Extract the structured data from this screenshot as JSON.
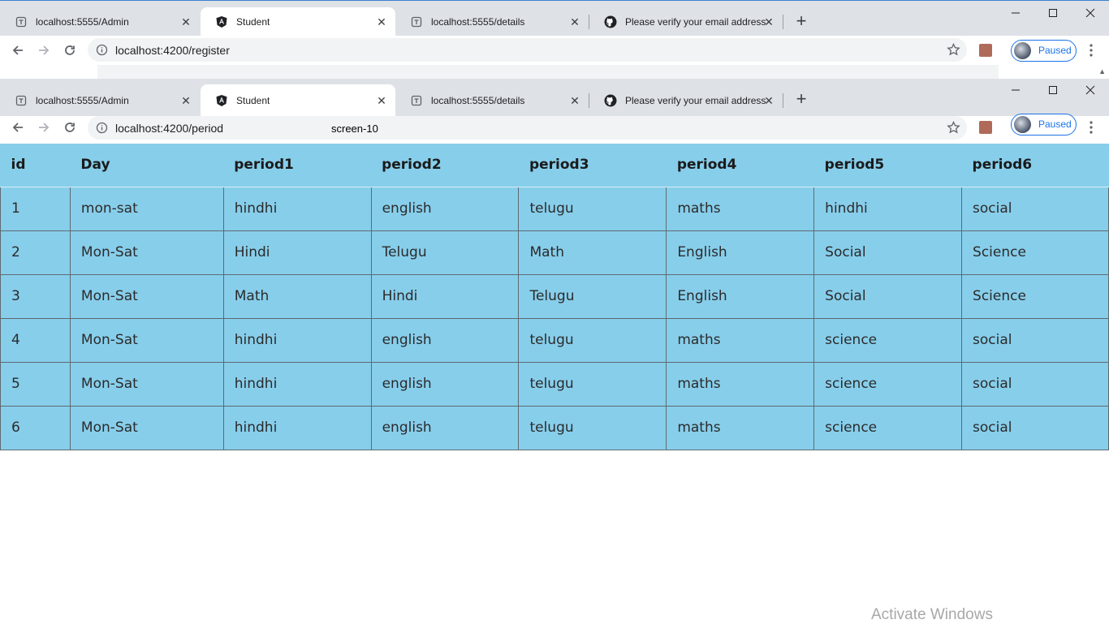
{
  "back_window": {
    "tabs": [
      {
        "label": "localhost:5555/Admin",
        "icon": "page-icon",
        "active": false
      },
      {
        "label": "Student",
        "icon": "angular-icon",
        "active": true
      },
      {
        "label": "localhost:5555/details",
        "icon": "page-icon",
        "active": false
      },
      {
        "label": "Please verify your email address",
        "icon": "github-icon",
        "active": false
      }
    ],
    "url": "localhost:4200/register",
    "profile_label": "Paused"
  },
  "front_window": {
    "tabs": [
      {
        "label": "localhost:5555/Admin",
        "icon": "page-icon",
        "active": false
      },
      {
        "label": "Student",
        "icon": "angular-icon",
        "active": true
      },
      {
        "label": "localhost:5555/details",
        "icon": "page-icon",
        "active": false
      },
      {
        "label": "Please verify your email address",
        "icon": "github-icon",
        "active": false
      }
    ],
    "url": "localhost:4200/period",
    "overlay_label": "screen-10",
    "profile_label": "Paused"
  },
  "table": {
    "headers": [
      "id",
      "Day",
      "period1",
      "period2",
      "period3",
      "period4",
      "period5",
      "period6"
    ],
    "rows": [
      [
        "1",
        "mon-sat",
        "hindhi",
        "english",
        "telugu",
        "maths",
        "hindhi",
        "social"
      ],
      [
        "2",
        "Mon-Sat",
        "Hindi",
        "Telugu",
        "Math",
        "English",
        "Social",
        "Science"
      ],
      [
        "3",
        "Mon-Sat",
        "Math",
        "Hindi",
        "Telugu",
        "English",
        "Social",
        "Science"
      ],
      [
        "4",
        "Mon-Sat",
        "hindhi",
        "english",
        "telugu",
        "maths",
        "science",
        "social"
      ],
      [
        "5",
        "Mon-Sat",
        "hindhi",
        "english",
        "telugu",
        "maths",
        "science",
        "social"
      ],
      [
        "6",
        "Mon-Sat",
        "hindhi",
        "english",
        "telugu",
        "maths",
        "science",
        "social"
      ]
    ]
  },
  "watermark": "Activate Windows",
  "colors": {
    "table_bg": "#87ceeb",
    "tabstrip_bg": "#dee1e6",
    "accent": "#1a73e8"
  }
}
